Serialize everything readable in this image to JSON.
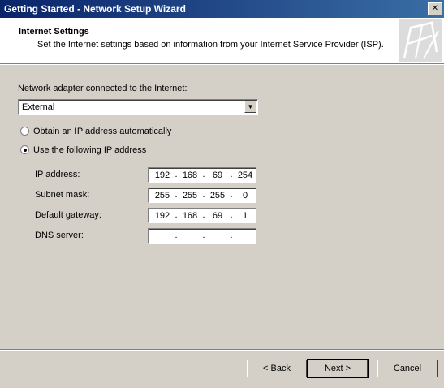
{
  "window": {
    "title": "Getting Started - Network Setup Wizard",
    "close_glyph": "✕"
  },
  "header": {
    "title": "Internet Settings",
    "subtitle": "Set the Internet settings based on information from your Internet Service Provider (ISP)."
  },
  "adapter": {
    "label": "Network adapter connected to the Internet:",
    "value": "External"
  },
  "ip_mode": {
    "auto_label": "Obtain an IP address automatically",
    "manual_label": "Use the following IP address",
    "selected": "manual"
  },
  "fields": {
    "ip": {
      "label": "IP address:",
      "octets": [
        "192",
        "168",
        "69",
        "254"
      ]
    },
    "subnet": {
      "label": "Subnet mask:",
      "octets": [
        "255",
        "255",
        "255",
        "0"
      ]
    },
    "gateway": {
      "label": "Default gateway:",
      "octets": [
        "192",
        "168",
        "69",
        "1"
      ]
    },
    "dns": {
      "label": "DNS server:",
      "octets": [
        "",
        "",
        "",
        ""
      ]
    }
  },
  "buttons": {
    "back": "< Back",
    "next": "Next >",
    "cancel": "Cancel"
  },
  "icons": {
    "logo": "network-logo-icon",
    "dropdown": "chevron-down-icon"
  }
}
